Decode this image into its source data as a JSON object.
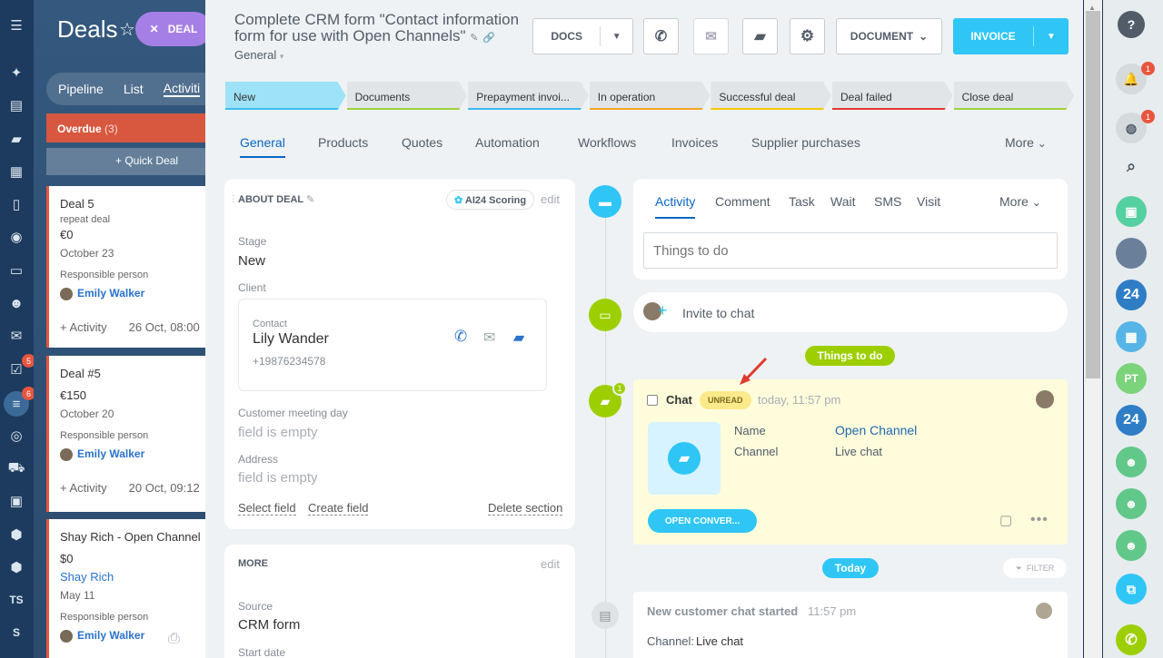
{
  "kanban": {
    "title": "Deals",
    "deal_button": "DEAL",
    "tabs": [
      "Pipeline",
      "List",
      "Activiti"
    ],
    "overdue_label": "Overdue",
    "overdue_count": "(3)",
    "quick_deal": "+ Quick Deal",
    "cards": [
      {
        "title": "Deal 5",
        "sub": "repeat deal",
        "amount": "€0",
        "date": "October 23",
        "resp_label": "Responsible person",
        "person": "Emily Walker",
        "activity": "+ Activity",
        "activity_date": "26 Oct, 08:00"
      },
      {
        "title": "Deal #5",
        "sub": "",
        "amount": "€150",
        "date": "October 20",
        "resp_label": "Responsible person",
        "person": "Emily Walker",
        "activity": "+ Activity",
        "activity_date": "20 Oct, 09:12"
      },
      {
        "title": "Shay Rich - Open Channel",
        "sub": "",
        "amount": "$0",
        "date": "Shay Rich",
        "date2": "May 11",
        "resp_label": "Responsible person",
        "person": "Emily Walker",
        "activity": "",
        "activity_date": ""
      }
    ]
  },
  "left_nav": {
    "badge_tasks": "5",
    "badge_deals": "6",
    "ts": "TS",
    "s": "S"
  },
  "header": {
    "title": "Complete CRM form \"Contact information form for use with Open Channels\"",
    "category": "General",
    "docs": "DOCS",
    "document": "DOCUMENT",
    "invoice": "INVOICE"
  },
  "stages": [
    {
      "label": "New",
      "color": "#9ee2f7",
      "line": "#39c0ee"
    },
    {
      "label": "Documents",
      "color": "#e1e5e8",
      "line": "#9cd43c"
    },
    {
      "label": "Prepayment invoi...",
      "color": "#e1e5e8",
      "line": "#3bb8ef"
    },
    {
      "label": "In operation",
      "color": "#e1e5e8",
      "line": "#f5a623"
    },
    {
      "label": "Successful deal",
      "color": "#e1e5e8",
      "line": "#f5c900"
    },
    {
      "label": "Deal failed",
      "color": "#e1e5e8",
      "line": "#e03a2f"
    },
    {
      "label": "Close deal",
      "color": "#e1e5e8",
      "line": "#9cd43c"
    }
  ],
  "tabs": [
    "General",
    "Products",
    "Quotes",
    "Automation",
    "Workflows",
    "Invoices",
    "Supplier purchases",
    "More"
  ],
  "about": {
    "heading": "ABOUT DEAL",
    "scoring": "AI24 Scoring",
    "edit": "edit",
    "stage_label": "Stage",
    "stage_value": "New",
    "client_label": "Client",
    "contact_label": "Contact",
    "contact_name": "Lily Wander",
    "contact_phone": "+19876234578",
    "meeting_label": "Customer meeting day",
    "meeting_value": "field is empty",
    "address_label": "Address",
    "address_value": "field is empty",
    "select_field": "Select field",
    "create_field": "Create field",
    "delete_section": "Delete section"
  },
  "more": {
    "heading": "MORE",
    "edit": "edit",
    "source_label": "Source",
    "source_value": "CRM form",
    "start_label": "Start date"
  },
  "activity": {
    "tabs": [
      "Activity",
      "Comment",
      "Task",
      "Wait",
      "SMS",
      "Visit",
      "More"
    ],
    "placeholder": "Things to do",
    "invite": "Invite to chat",
    "things_to_do": "Things to do",
    "chat_title": "Chat",
    "unread": "UNREAD",
    "chat_time": "today, 11:57 pm",
    "name_label": "Name",
    "name_value": "Open Channel",
    "channel_label": "Channel",
    "channel_value": "Live chat",
    "open_btn": "OPEN CONVER...",
    "chat_badge": "1",
    "today": "Today",
    "filter": "FILTER",
    "new_chat": "New customer chat started",
    "new_chat_time": "11:57 pm",
    "channel_line_label": "Channel:",
    "channel_line_value": "Live chat"
  },
  "right_nav": {
    "bell_badge": "1",
    "chat_badge": "1",
    "pt": "PT",
    "n24": "24"
  }
}
